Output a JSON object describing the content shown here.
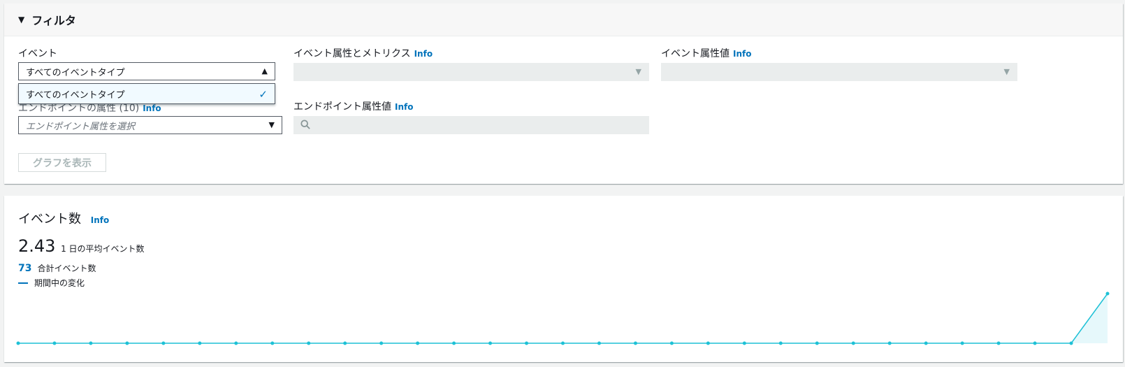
{
  "filter": {
    "title": "フィルタ",
    "event_label": "イベント",
    "event_selected": "すべてのイベントタイプ",
    "event_options": [
      "すべてのイベントタイプ"
    ],
    "attr_metrics_label": "イベント属性とメトリクス",
    "attr_value_label": "イベント属性値",
    "endpoint_attr_label": "エンドポイントの属性 (10)",
    "endpoint_attr_placeholder": "エンドポイント属性を選択",
    "endpoint_value_label": "エンドポイント属性値",
    "info": "Info",
    "show_graph": "グラフを表示"
  },
  "metrics": {
    "title": "イベント数",
    "info": "Info",
    "avg_value": "2.43",
    "avg_label": "1 日の平均イベント数",
    "total_value": "73",
    "total_label": "合計イベント数",
    "legend_label": "期間中の変化"
  },
  "colors": {
    "accent": "#0073bb",
    "chart_line": "#1ec1d6"
  },
  "chart_data": {
    "type": "area",
    "title": "",
    "xlabel": "",
    "ylabel": "",
    "x": [
      1,
      2,
      3,
      4,
      5,
      6,
      7,
      8,
      9,
      10,
      11,
      12,
      13,
      14,
      15,
      16,
      17,
      18,
      19,
      20,
      21,
      22,
      23,
      24,
      25,
      26,
      27,
      28,
      29,
      30,
      31
    ],
    "values": [
      0,
      0,
      0,
      0,
      0,
      0,
      0,
      0,
      0,
      0,
      0,
      0,
      0,
      0,
      0,
      0,
      0,
      0,
      0,
      0,
      0,
      0,
      0,
      0,
      0,
      0,
      0,
      0,
      0,
      0,
      73
    ],
    "ylim": [
      0,
      73
    ],
    "grid": false
  }
}
